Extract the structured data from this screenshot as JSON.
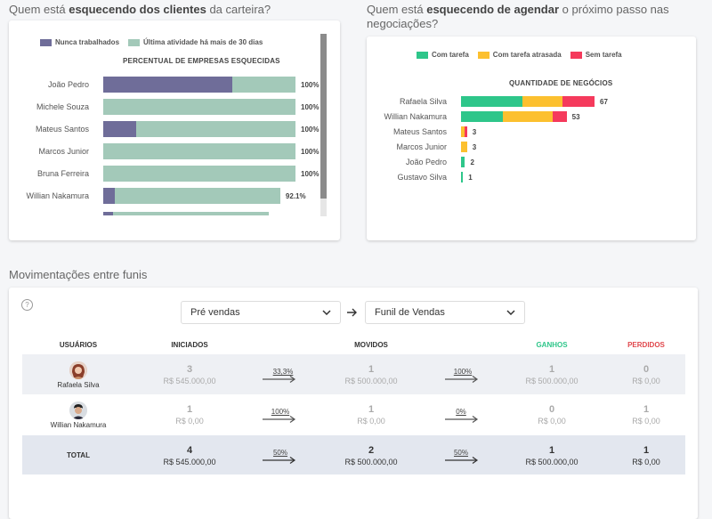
{
  "left_panel": {
    "title_pre": "Quem está",
    "title_bold": "esquecendo dos clientes",
    "title_post": "da carteira?",
    "legend": [
      {
        "label": "Nunca trabalhados",
        "color": "#6f6d99"
      },
      {
        "label": "Última atividade há mais de 30 dias",
        "color": "#a3c9b9"
      }
    ],
    "chart_title": "PERCENTUAL DE EMPRESAS ESQUECIDAS"
  },
  "right_panel": {
    "title_pre": "Quem está",
    "title_bold": "esquecendo de agendar",
    "title_post": "o próximo passo nas negociações?",
    "legend": [
      {
        "label": "Com tarefa",
        "color": "#2ec68a"
      },
      {
        "label": "Com tarefa atrasada",
        "color": "#fcc02f"
      },
      {
        "label": "Sem tarefa",
        "color": "#f53a5c"
      }
    ],
    "chart_title": "QUANTIDADE DE NEGÓCIOS"
  },
  "chart_data": [
    {
      "type": "bar",
      "orientation": "horizontal",
      "title": "PERCENTUAL DE EMPRESAS ESQUECIDAS",
      "categories": [
        "João Pedro",
        "Michele Souza",
        "Mateus Santos",
        "Marcos Junior",
        "Bruna Ferreira",
        "Willian Nakamura"
      ],
      "series": [
        {
          "name": "Nunca trabalhados",
          "values": [
            67,
            0,
            17,
            0,
            0,
            6
          ]
        },
        {
          "name": "Última atividade há mais de 30 dias",
          "values": [
            33,
            100,
            83,
            100,
            100,
            86.1
          ]
        }
      ],
      "total_labels": [
        "100%",
        "100%",
        "100%",
        "100%",
        "100%",
        "92.1%"
      ],
      "xlim": [
        0,
        100
      ],
      "stacked": true,
      "legend": "top-left"
    },
    {
      "type": "bar",
      "orientation": "horizontal",
      "title": "QUANTIDADE DE NEGÓCIOS",
      "categories": [
        "Rafaela Silva",
        "Willian Nakamura",
        "Mateus Santos",
        "Marcos Junior",
        "João Pedro",
        "Gustavo Silva"
      ],
      "series": [
        {
          "name": "Com tarefa",
          "values": [
            31,
            21,
            0,
            0,
            2,
            1
          ]
        },
        {
          "name": "Com tarefa atrasada",
          "values": [
            20,
            25,
            2,
            3,
            0,
            0
          ]
        },
        {
          "name": "Sem tarefa",
          "values": [
            16,
            7,
            1,
            0,
            0,
            0
          ]
        }
      ],
      "totals": [
        67,
        53,
        3,
        3,
        2,
        1
      ],
      "xlim": [
        0,
        67
      ],
      "stacked": true,
      "legend": "top-center"
    }
  ],
  "funnel": {
    "section_title": "Movimentações entre funis",
    "help_icon": "?",
    "from_select": "Pré vendas",
    "to_select": "Funil de Vendas",
    "headers": {
      "users": "USUÁRIOS",
      "started": "INICIADOS",
      "moved": "MOVIDOS",
      "won": "GANHOS",
      "lost": "PERDIDOS"
    },
    "colors": {
      "won": "#2ec68a",
      "lost": "#e0474c"
    },
    "rows": [
      {
        "name": "Rafaela Silva",
        "started": "3",
        "started_money": "R$ 545.000,00",
        "pct1": "33,3%",
        "moved": "1",
        "moved_money": "R$ 500.000,00",
        "pct2": "100%",
        "won": "1",
        "won_money": "R$ 500.000,00",
        "lost": "0",
        "lost_money": "R$ 0,00"
      },
      {
        "name": "Willian Nakamura",
        "started": "1",
        "started_money": "R$ 0,00",
        "pct1": "100%",
        "moved": "1",
        "moved_money": "R$ 0,00",
        "pct2": "0%",
        "won": "0",
        "won_money": "R$ 0,00",
        "lost": "1",
        "lost_money": "R$ 0,00"
      }
    ],
    "total": {
      "name": "TOTAL",
      "started": "4",
      "started_money": "R$ 545.000,00",
      "pct1": "50%",
      "moved": "2",
      "moved_money": "R$ 500.000,00",
      "pct2": "50%",
      "won": "1",
      "won_money": "R$ 500.000,00",
      "lost": "1",
      "lost_money": "R$ 0,00"
    }
  }
}
